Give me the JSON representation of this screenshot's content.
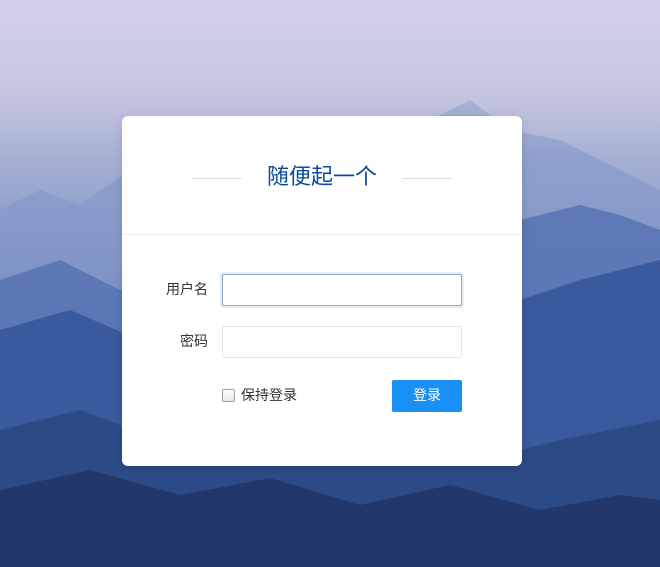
{
  "background": {
    "image": "misty-blue-mountains",
    "accent": "#1890f5"
  },
  "login": {
    "title": "随便起一个",
    "username_label": "用户名",
    "username_value": "",
    "password_label": "密码",
    "password_value": "",
    "remember_label": "保持登录",
    "remember_checked": false,
    "submit_label": "登录"
  }
}
